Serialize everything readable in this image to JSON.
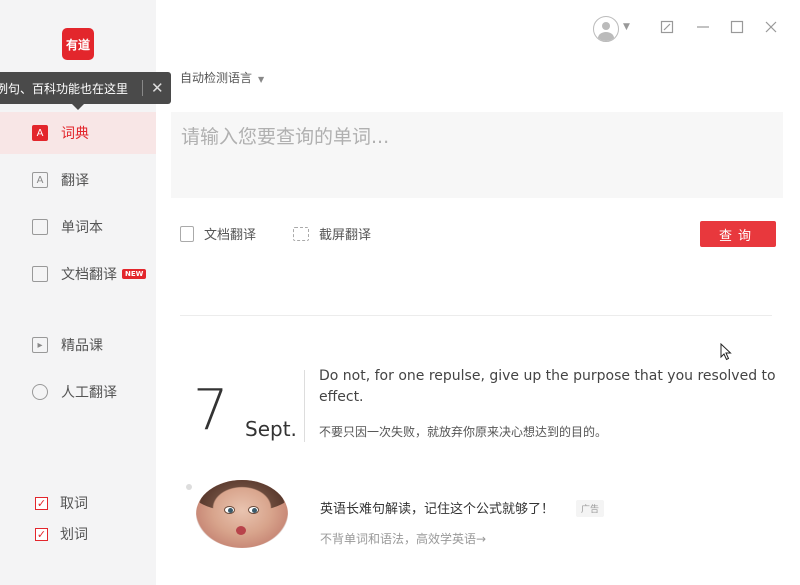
{
  "sidebar": {
    "logo_text": "有道",
    "tooltip": {
      "text": "例句、百科功能也在这里",
      "close_glyph": "✕"
    },
    "items": [
      {
        "label": "词典",
        "icon": "dictionary-icon",
        "active": true
      },
      {
        "label": "翻译",
        "icon": "translate-icon",
        "active": false
      },
      {
        "label": "单词本",
        "icon": "wordbook-icon",
        "active": false
      },
      {
        "label": "文档翻译",
        "icon": "document-translate-icon",
        "badge": "NEW",
        "active": false
      },
      {
        "label": "精品课",
        "icon": "course-play-icon",
        "active": false
      },
      {
        "label": "人工翻译",
        "icon": "human-translate-icon",
        "active": false
      }
    ],
    "checks": [
      {
        "label": "取词",
        "checked": true
      },
      {
        "label": "划词",
        "checked": true
      }
    ]
  },
  "header": {
    "window_controls": [
      "restore-icon",
      "minimize-icon",
      "maximize-icon",
      "close-icon"
    ]
  },
  "main": {
    "language_select": "自动检测语言",
    "search_placeholder": "请输入您要查询的单词...",
    "tools": [
      {
        "label": "文档翻译",
        "icon": "document-icon"
      },
      {
        "label": "截屏翻译",
        "icon": "screenshot-icon"
      }
    ],
    "query_button": "查询"
  },
  "daily": {
    "day": "7",
    "month": "Sept.",
    "sentence_en": "Do not, for one repulse, give up the purpose that you resolved to ef­fect.",
    "sentence_cn": "不要只因一次失败，就放弃你原来决心想达到的目的。"
  },
  "ad": {
    "title": "英语长难句解读，记住这个公式就够了！",
    "badge": "广告",
    "subtitle": "不背单词和语法，高效学英语→"
  },
  "colors": {
    "accent": "#e3262c",
    "sidebar_bg": "#f4f4f5"
  }
}
